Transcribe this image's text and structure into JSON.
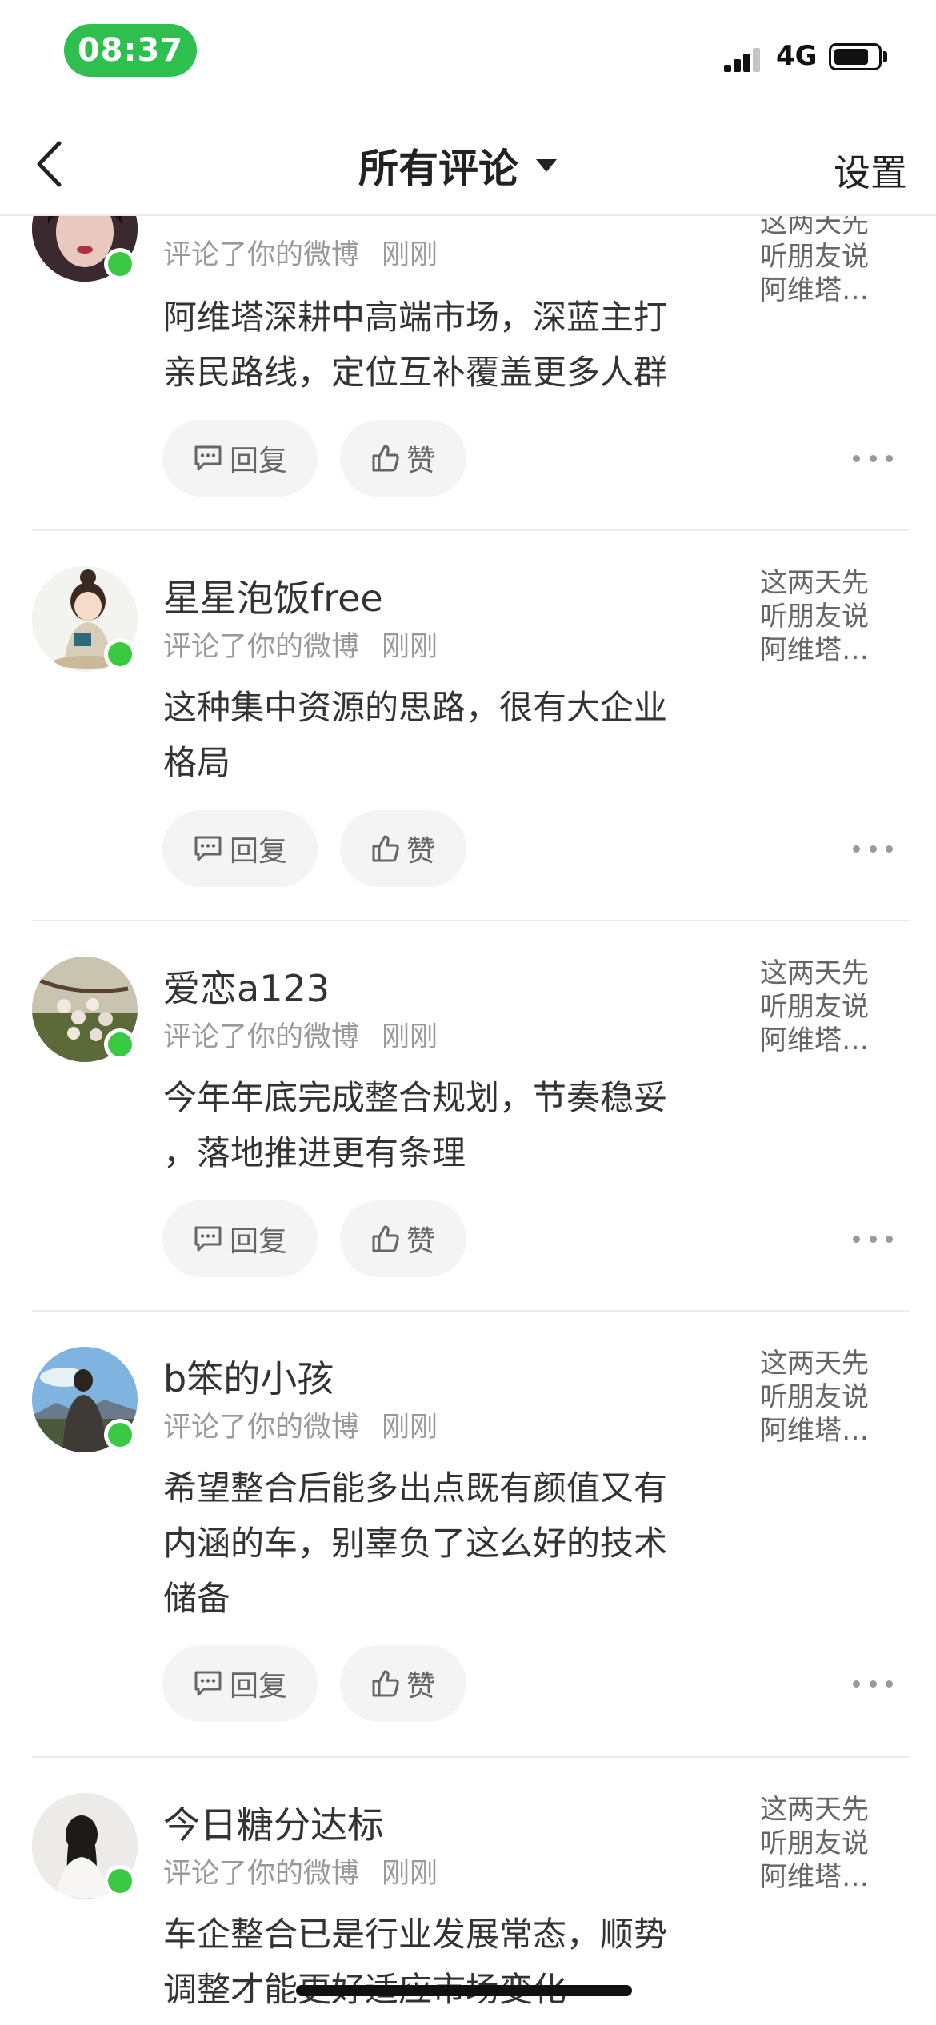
{
  "status_bar": {
    "time": "08:37",
    "network": "4G"
  },
  "nav": {
    "title": "所有评论",
    "settings_label": "设置"
  },
  "actions": {
    "reply_label": "回复",
    "like_label": "赞"
  },
  "comments": [
    {
      "username": "",
      "action_text": "评论了你的微博",
      "time": "刚刚",
      "body_lines": [
        "阿维塔深耕中高端市场，深蓝主打",
        "亲民路线，定位互补覆盖更多人群"
      ],
      "quote_lines": [
        "这两天先",
        "听朋友说",
        "阿维塔…"
      ]
    },
    {
      "username": "星星泡饭free",
      "action_text": "评论了你的微博",
      "time": "刚刚",
      "body_lines": [
        "这种集中资源的思路，很有大企业",
        "格局"
      ],
      "quote_lines": [
        "这两天先",
        "听朋友说",
        "阿维塔…"
      ]
    },
    {
      "username": "爱恋a123",
      "action_text": "评论了你的微博",
      "time": "刚刚",
      "body_lines": [
        "今年年底完成整合规划，节奏稳妥",
        "，落地推进更有条理"
      ],
      "quote_lines": [
        "这两天先",
        "听朋友说",
        "阿维塔…"
      ]
    },
    {
      "username": "b笨的小孩",
      "action_text": "评论了你的微博",
      "time": "刚刚",
      "body_lines": [
        "希望整合后能多出点既有颜值又有",
        "内涵的车，别辜负了这么好的技术",
        "储备"
      ],
      "quote_lines": [
        "这两天先",
        "听朋友说",
        "阿维塔…"
      ]
    },
    {
      "username": "今日糖分达标",
      "action_text": "评论了你的微博",
      "time": "刚刚",
      "body_lines": [
        "车企整合已是行业发展常态，顺势",
        "调整才能更好适应市场变化"
      ],
      "quote_lines": [
        "这两天先",
        "听朋友说",
        "阿维塔…"
      ]
    }
  ]
}
